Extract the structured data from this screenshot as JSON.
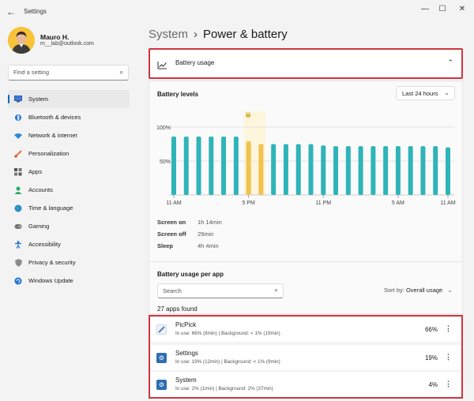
{
  "window": {
    "title": "Settings",
    "back_glyph": "←",
    "minimize_glyph": "—",
    "maximize_glyph": "☐",
    "close_glyph": "✕"
  },
  "user": {
    "name": "Mauro H.",
    "email": "m__lab@outlook.com"
  },
  "search": {
    "placeholder": "Find a setting"
  },
  "sidebar": {
    "items": [
      {
        "label": "System",
        "icon": "monitor-icon",
        "active": true
      },
      {
        "label": "Bluetooth & devices",
        "icon": "bluetooth-icon"
      },
      {
        "label": "Network & internet",
        "icon": "wifi-icon"
      },
      {
        "label": "Personalization",
        "icon": "brush-icon"
      },
      {
        "label": "Apps",
        "icon": "apps-icon"
      },
      {
        "label": "Accounts",
        "icon": "person-icon"
      },
      {
        "label": "Time & language",
        "icon": "globe-icon"
      },
      {
        "label": "Gaming",
        "icon": "gamepad-icon"
      },
      {
        "label": "Accessibility",
        "icon": "accessibility-icon"
      },
      {
        "label": "Privacy & security",
        "icon": "shield-icon"
      },
      {
        "label": "Windows Update",
        "icon": "update-icon"
      }
    ]
  },
  "breadcrumb": {
    "parent": "System",
    "separator": "›",
    "current": "Power & battery"
  },
  "battery_usage": {
    "label": "Battery usage",
    "chevron": "⌃"
  },
  "battery_levels": {
    "title": "Battery levels",
    "range": "Last 24 hours",
    "stats": [
      {
        "label": "Screen on",
        "value": "1h 14min"
      },
      {
        "label": "Screen off",
        "value": "29min"
      },
      {
        "label": "Sleep",
        "value": "4h 4min"
      }
    ]
  },
  "chart_data": {
    "type": "bar",
    "y_ticks": [
      "100%",
      "50%"
    ],
    "ylim": [
      0,
      100
    ],
    "x_ticks": [
      "11 AM",
      "5 PM",
      "11 PM",
      "5 AM",
      "11 AM"
    ],
    "values": [
      86,
      86,
      86,
      86,
      86,
      86,
      79,
      75,
      75,
      75,
      75,
      75,
      73,
      72,
      72,
      72,
      72,
      72,
      72,
      72,
      72,
      72,
      70
    ],
    "highlight_indices": [
      6,
      7
    ],
    "colors": {
      "normal": "#2fb4b8",
      "highlight": "#f2c14f",
      "highlight_band": "#fdf6dc"
    }
  },
  "per_app": {
    "title": "Battery usage per app",
    "search_placeholder": "Search",
    "sort_label": "Sort by:",
    "sort_value": "Overall usage",
    "found": "27 apps found",
    "apps": [
      {
        "name": "PicPick",
        "detail": "In use: 66% (8min) | Background: < 1% (19min)",
        "percent": "66%",
        "icon": "picpick-icon",
        "icon_color": "#5a7fb8"
      },
      {
        "name": "Settings",
        "detail": "In use: 19% (12min) | Background: < 1% (9min)",
        "percent": "19%",
        "icon": "gear-icon",
        "icon_color": "#2f6db0"
      },
      {
        "name": "System",
        "detail": "In use: 2% (1min) | Background: 2% (37min)",
        "percent": "4%",
        "icon": "system-icon",
        "icon_color": "#2f6db0"
      }
    ]
  }
}
